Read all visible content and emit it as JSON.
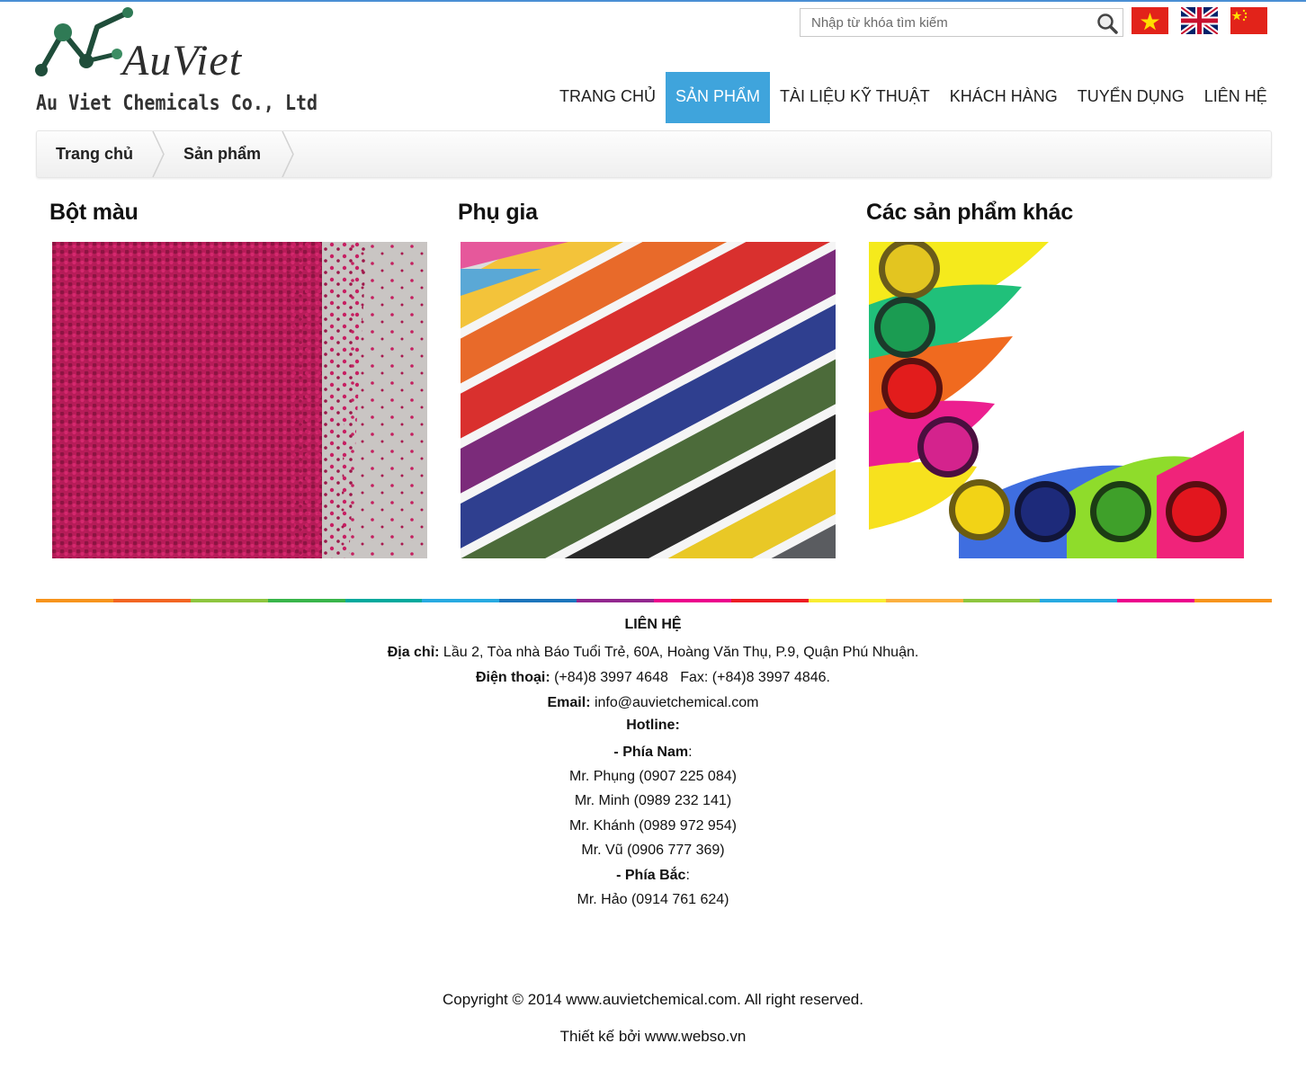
{
  "brand": {
    "name": "AuViet",
    "tagline": "Au Viet Chemicals Co., Ltd"
  },
  "search": {
    "placeholder": "Nhập từ khóa tìm kiếm"
  },
  "languages": [
    "vietnam-flag-icon",
    "uk-flag-icon",
    "china-flag-icon"
  ],
  "nav": {
    "items": [
      {
        "label": "TRANG CHỦ",
        "active": false
      },
      {
        "label": "SẢN PHẨM",
        "active": true
      },
      {
        "label": "TÀI LIỆU KỸ THUẬT",
        "active": false
      },
      {
        "label": "KHÁCH HÀNG",
        "active": false
      },
      {
        "label": "TUYỂN DỤNG",
        "active": false
      },
      {
        "label": "LIÊN HỆ",
        "active": false
      }
    ]
  },
  "breadcrumb": [
    "Trang chủ",
    "Sản phẩm"
  ],
  "categories": [
    {
      "title": "Bột màu"
    },
    {
      "title": "Phụ gia"
    },
    {
      "title": "Các sản phẩm khác"
    }
  ],
  "contact": {
    "title": "LIÊN HỆ",
    "address_label": "Địa chỉ:",
    "address": " Lầu 2, Tòa nhà Báo Tuổi Trẻ, 60A, Hoàng Văn Thụ, P.9, Quận Phú Nhuận.",
    "phone_label": "Điện thoại:",
    "phone": " (+84)8 3997 4648   Fax: (+84)8 3997 4846.",
    "email_label": "Email:",
    "email": " info@auvietchemical.com",
    "hotline_title": "Hotline:",
    "south_label": "- Phía Nam",
    "south_colon": ":",
    "south": [
      "Mr. Phụng (0907 225 084)",
      "Mr. Minh (0989 232 141)",
      "Mr. Khánh (0989 972 954)",
      "Mr. Vũ (0906 777 369)"
    ],
    "north_label": "- Phía Bắc",
    "north_colon": ":",
    "north": [
      "Mr. Hảo (0914 761 624)"
    ]
  },
  "copyright": "Copyright © 2014 www.auvietchemical.com. All right reserved.",
  "designer": "Thiết kế bởi www.webso.vn",
  "colors": {
    "accent": "#3fa4dc",
    "top_border": "#4a8fd4",
    "rainbow": [
      "#f7941d",
      "#f26522",
      "#8dc63f",
      "#39b54a",
      "#00a99d",
      "#27aae1",
      "#1c75bc",
      "#92278f",
      "#ec008c",
      "#ed1c24",
      "#f9ed32",
      "#fbb040"
    ]
  }
}
